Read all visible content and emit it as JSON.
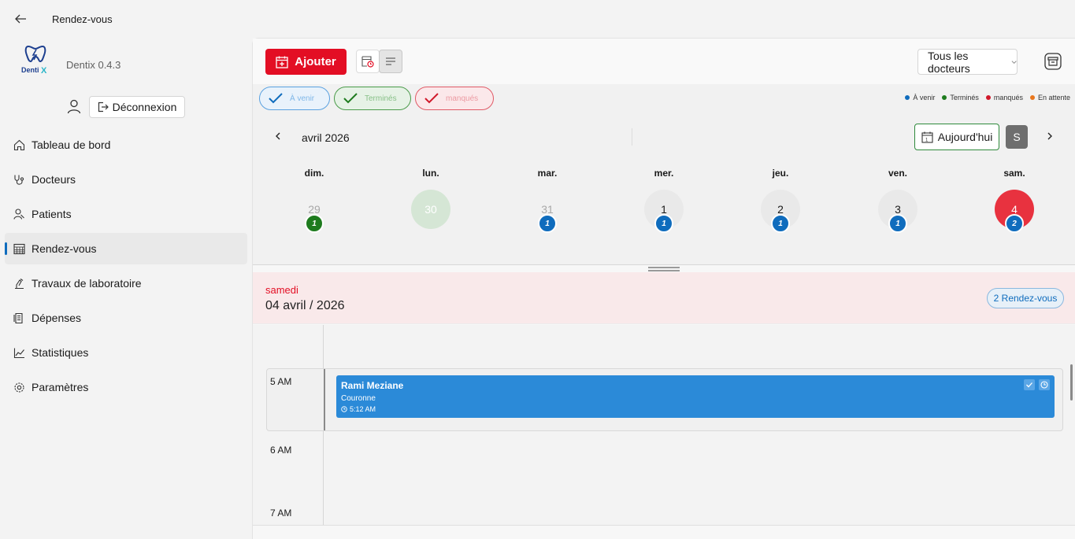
{
  "window": {
    "title": "Rendez-vous"
  },
  "app": {
    "logo_text": "DentiX",
    "version": "Dentix 0.4.3"
  },
  "auth": {
    "logout_label": "Déconnexion"
  },
  "sidebar": {
    "items": [
      {
        "label": "Tableau de bord",
        "icon": "home-icon",
        "active": false
      },
      {
        "label": "Docteurs",
        "icon": "stethoscope-icon",
        "active": false
      },
      {
        "label": "Patients",
        "icon": "patients-icon",
        "active": false
      },
      {
        "label": "Rendez-vous",
        "icon": "calendar-icon",
        "active": true
      },
      {
        "label": "Travaux de laboratoire",
        "icon": "lab-icon",
        "active": false
      },
      {
        "label": "Dépenses",
        "icon": "receipt-icon",
        "active": false
      },
      {
        "label": "Statistiques",
        "icon": "chart-icon",
        "active": false
      },
      {
        "label": "Paramètres",
        "icon": "gear-icon",
        "active": false
      }
    ]
  },
  "toolbar": {
    "add_label": "Ajouter",
    "doctor_select": "Tous les docteurs",
    "accent": "#e30e24"
  },
  "filters": [
    {
      "label": "À venir",
      "color": "#0f6cbd"
    },
    {
      "label": "Terminés",
      "color": "#1e7b1e"
    },
    {
      "label": "manqués",
      "color": "#d0182a"
    }
  ],
  "legend": [
    {
      "label": "À venir",
      "color": "#0f6cbd"
    },
    {
      "label": "Terminés",
      "color": "#1e7b1e"
    },
    {
      "label": "manqués",
      "color": "#d0182a"
    },
    {
      "label": "En attente",
      "color": "#e8761c"
    }
  ],
  "calendar": {
    "month_label": "avril 2026",
    "today_label": "Aujourd'hui",
    "view_letter": "S",
    "days": [
      {
        "name": "dim.",
        "number": "29",
        "count": "1",
        "badge_color": "#1e7b1e",
        "style": "muted"
      },
      {
        "name": "lun.",
        "number": "30",
        "count": "",
        "badge_color": "",
        "style": "today"
      },
      {
        "name": "mar.",
        "number": "31",
        "count": "1",
        "badge_color": "#0f6cbd",
        "style": "muted"
      },
      {
        "name": "mer.",
        "number": "1",
        "count": "1",
        "badge_color": "#0f6cbd",
        "style": "plain"
      },
      {
        "name": "jeu.",
        "number": "2",
        "count": "1",
        "badge_color": "#0f6cbd",
        "style": "plain"
      },
      {
        "name": "ven.",
        "number": "3",
        "count": "1",
        "badge_color": "#0f6cbd",
        "style": "plain"
      },
      {
        "name": "sam.",
        "number": "4",
        "count": "2",
        "badge_color": "#0f6cbd",
        "style": "selected"
      }
    ]
  },
  "day_view": {
    "weekday": "samedi",
    "date": "04 avril / 2026",
    "count_badge": "2 Rendez-vous",
    "hours": [
      "5 AM",
      "6 AM",
      "7 AM"
    ],
    "event": {
      "patient": "Rami Meziane",
      "type": "Couronne",
      "time": "5:12 AM",
      "color": "#2b8ad8"
    }
  }
}
